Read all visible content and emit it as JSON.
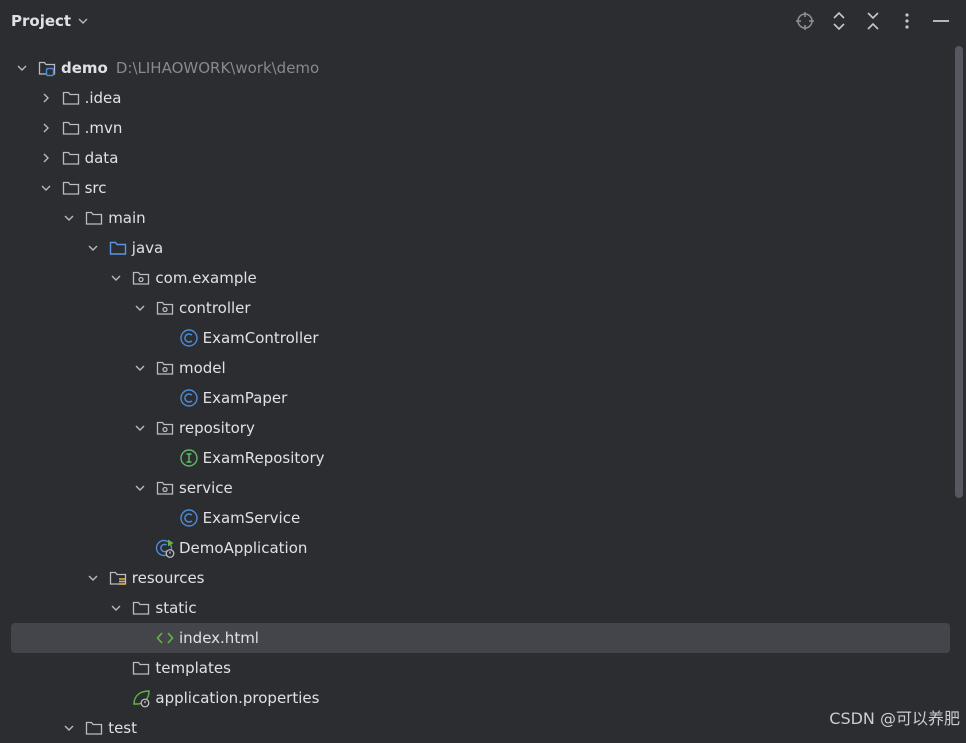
{
  "header": {
    "title": "Project"
  },
  "tree": [
    {
      "id": "demo",
      "label": "demo",
      "path": "D:\\LIHAOWORK\\work\\demo",
      "depth": 0,
      "expanded": true,
      "icon": "module-icon",
      "bold": true
    },
    {
      "id": "idea",
      "label": ".idea",
      "depth": 1,
      "expanded": false,
      "icon": "folder-icon"
    },
    {
      "id": "mvn",
      "label": ".mvn",
      "depth": 1,
      "expanded": false,
      "icon": "folder-icon"
    },
    {
      "id": "data",
      "label": "data",
      "depth": 1,
      "expanded": false,
      "icon": "folder-icon"
    },
    {
      "id": "src",
      "label": "src",
      "depth": 1,
      "expanded": true,
      "icon": "folder-icon"
    },
    {
      "id": "main",
      "label": "main",
      "depth": 2,
      "expanded": true,
      "icon": "folder-icon"
    },
    {
      "id": "java",
      "label": "java",
      "depth": 3,
      "expanded": true,
      "icon": "source-folder-icon"
    },
    {
      "id": "com-example",
      "label": "com.example",
      "depth": 4,
      "expanded": true,
      "icon": "package-icon"
    },
    {
      "id": "controller",
      "label": "controller",
      "depth": 5,
      "expanded": true,
      "icon": "package-icon"
    },
    {
      "id": "exam-controller",
      "label": "ExamController",
      "depth": 6,
      "icon": "class-icon"
    },
    {
      "id": "model",
      "label": "model",
      "depth": 5,
      "expanded": true,
      "icon": "package-icon"
    },
    {
      "id": "exam-paper",
      "label": "ExamPaper",
      "depth": 6,
      "icon": "class-icon"
    },
    {
      "id": "repository",
      "label": "repository",
      "depth": 5,
      "expanded": true,
      "icon": "package-icon"
    },
    {
      "id": "exam-repository",
      "label": "ExamRepository",
      "depth": 6,
      "icon": "interface-icon"
    },
    {
      "id": "service",
      "label": "service",
      "depth": 5,
      "expanded": true,
      "icon": "package-icon"
    },
    {
      "id": "exam-service",
      "label": "ExamService",
      "depth": 6,
      "icon": "class-icon"
    },
    {
      "id": "demo-application",
      "label": "DemoApplication",
      "depth": 5,
      "icon": "spring-boot-class-icon"
    },
    {
      "id": "resources",
      "label": "resources",
      "depth": 3,
      "expanded": true,
      "icon": "resources-folder-icon"
    },
    {
      "id": "static",
      "label": "static",
      "depth": 4,
      "expanded": true,
      "icon": "folder-icon"
    },
    {
      "id": "index-html",
      "label": "index.html",
      "depth": 5,
      "icon": "html-icon",
      "selected": true
    },
    {
      "id": "templates",
      "label": "templates",
      "depth": 4,
      "icon": "folder-icon"
    },
    {
      "id": "application-properties",
      "label": "application.properties",
      "depth": 4,
      "icon": "spring-properties-icon"
    },
    {
      "id": "test",
      "label": "test",
      "depth": 2,
      "expanded": true,
      "icon": "folder-icon"
    }
  ],
  "watermark": "CSDN @可以养肥",
  "colors": {
    "background": "#2b2d30",
    "selection": "#43454a",
    "class": "#4d8bd8",
    "interface": "#5fb865",
    "html": "#62b543"
  }
}
